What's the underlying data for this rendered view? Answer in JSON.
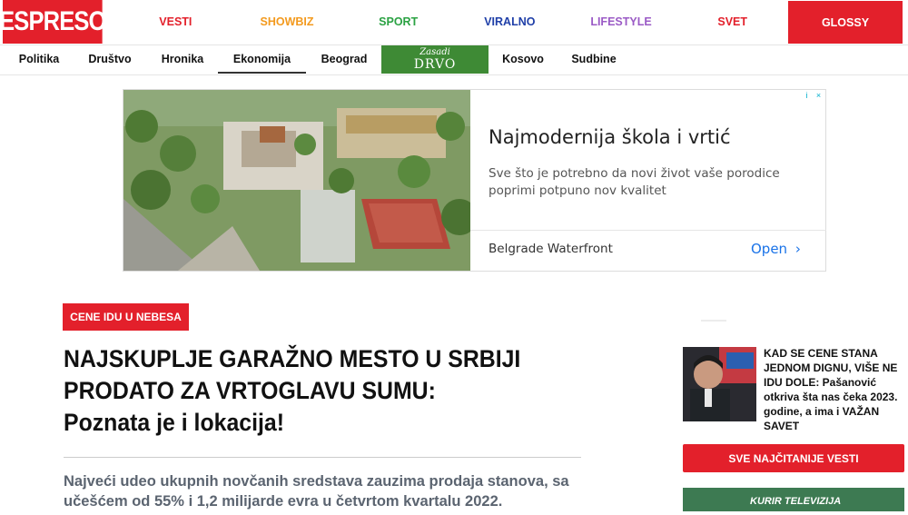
{
  "header": {
    "logo": "ESPRESO",
    "nav": [
      {
        "label": "VESTI",
        "color": "#e3202b"
      },
      {
        "label": "SHOWBIZ",
        "color": "#f39a1e"
      },
      {
        "label": "SPORT",
        "color": "#2ba243"
      },
      {
        "label": "VIRALNO",
        "color": "#1f3fa8"
      },
      {
        "label": "LIFESTYLE",
        "color": "#9b5bc6"
      },
      {
        "label": "SVET",
        "color": "#e3202b"
      }
    ],
    "glossy": "GLOSSY"
  },
  "subnav": {
    "items": [
      "Politika",
      "Društvo",
      "Hronika",
      "Ekonomija",
      "Beograd",
      "Kosovo",
      "Sudbine"
    ],
    "active": "Ekonomija",
    "drvo_line1": "Zasadi",
    "drvo_line2": "DRVO"
  },
  "ad": {
    "title": "Najmodernija škola i vrtić",
    "description": "Sve što je potrebno da novi život vaše porodice poprimi potpuno nov kvalitet",
    "brand": "Belgrade Waterfront",
    "cta": "Open",
    "cta_chevron": "›",
    "info_icon": "i",
    "close_icon": "×"
  },
  "article": {
    "category": "CENE IDU U NEBESA",
    "headline_lines": [
      "NAJSKUPLJE GARAŽNO MESTO U SRBIJI",
      "PRODATO ZA VRTOGLAVU SUMU:",
      "Poznata je i lokacija!"
    ],
    "lead": "Najveći udeo ukupnih novčanih sredstava zauzima prodaja stanova, sa učešćem od 55% i 1,2 milijarde evra u četvrtom kvartalu 2022."
  },
  "sidebar": {
    "story": "KAD SE CENE STANA JEDNOM DIGNU, VIŠE NE IDU DOLE: Pašanović otkriva šta nas čeka 2023. godine, a ima i VAŽAN SAVET",
    "button": "SVE NAJČITANIJE VESTI",
    "promo": "KURIR TELEVIZIJA"
  },
  "colors": {
    "brand_red": "#e3202b",
    "drvo_green": "#3e8a35",
    "link_blue": "#1a73e8"
  }
}
